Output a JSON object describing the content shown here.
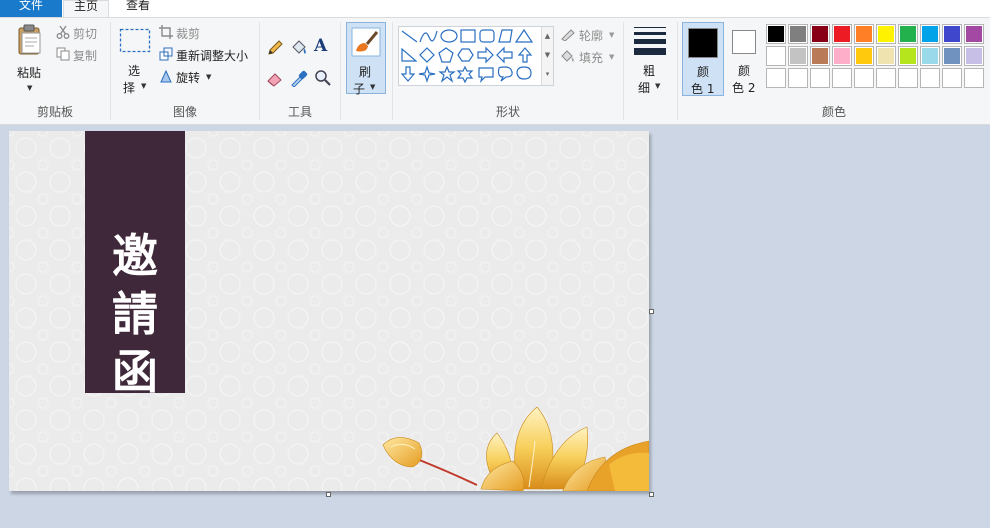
{
  "tabs": {
    "file": "文件",
    "home": "主页",
    "view": "查看"
  },
  "clipboard": {
    "paste": "粘贴",
    "cut": "剪切",
    "copy": "复制",
    "group": "剪贴板"
  },
  "image": {
    "select_line1": "选",
    "select_line2": "择",
    "crop": "裁剪",
    "resize": "重新调整大小",
    "rotate": "旋转",
    "group": "图像"
  },
  "tools": {
    "group": "工具",
    "text_glyph": "A"
  },
  "brush": {
    "line1": "刷",
    "line2": "子"
  },
  "shapes": {
    "outline": "轮廓",
    "fill": "填充",
    "group": "形状"
  },
  "size": {
    "line1": "粗",
    "line2": "细"
  },
  "colors": {
    "color1_line1": "颜",
    "color1_line2": "色 1",
    "color2_line1": "颜",
    "color2_line2": "色 2",
    "group": "颜色",
    "color1_value": "#000000",
    "color2_value": "#ffffff",
    "palette_row1": [
      "#000000",
      "#7f7f7f",
      "#880015",
      "#ed1c24",
      "#ff7f27",
      "#fff200",
      "#22b14c",
      "#00a2e8",
      "#3f48cc",
      "#a349a4"
    ],
    "palette_row2": [
      "#ffffff",
      "#c3c3c3",
      "#b97a57",
      "#ffaec9",
      "#ffc90e",
      "#efe4b0",
      "#b5e61d",
      "#99d9ea",
      "#7092be",
      "#c8bfe7"
    ],
    "palette_row3": [
      "#ffffff",
      "#ffffff",
      "#ffffff",
      "#ffffff",
      "#ffffff",
      "#ffffff",
      "#ffffff",
      "#ffffff",
      "#ffffff",
      "#ffffff"
    ]
  },
  "canvas": {
    "banner_title": "邀\n請\n函",
    "banner_color": "#3f2839"
  }
}
